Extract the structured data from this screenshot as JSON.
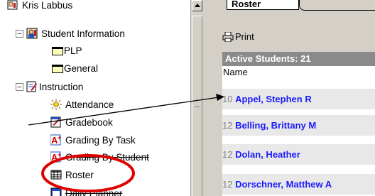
{
  "tree": {
    "items": [
      {
        "label": "Kris Labbus",
        "icon": "teacher-icon"
      },
      {
        "label": "Student Information",
        "icon": "student-info-icon",
        "expander": "−"
      },
      {
        "label": "PLP",
        "icon": "folder-icon"
      },
      {
        "label": "General",
        "icon": "folder-icon"
      },
      {
        "label": "Instruction",
        "icon": "instruction-icon",
        "expander": "−"
      },
      {
        "label": "Attendance",
        "icon": "attendance-icon"
      },
      {
        "label": "Gradebook",
        "icon": "gradebook-icon"
      },
      {
        "label": "Grading By Task",
        "icon": "grading-task-icon"
      },
      {
        "label": "Grading By Student",
        "icon": "grading-student-icon"
      },
      {
        "label": "Roster",
        "icon": "roster-icon"
      },
      {
        "label": "Daily Planner",
        "icon": "planner-icon"
      }
    ]
  },
  "tabs": {
    "active": "Roster"
  },
  "toolbar": {
    "print_label": "Print"
  },
  "roster": {
    "header": "Active Students: 21",
    "column": "Name",
    "rows": [
      {
        "grade": "10",
        "name": "Appel, Stephen R"
      },
      {
        "grade": "12",
        "name": "Belling, Brittany M"
      },
      {
        "grade": "12",
        "name": "Dolan, Heather"
      },
      {
        "grade": "12",
        "name": "Dorschner, Matthew A"
      }
    ]
  },
  "colors": {
    "highlight_circle": "#e00000",
    "student_name": "#1a1aff",
    "panel_header": "#8a8a8a"
  }
}
